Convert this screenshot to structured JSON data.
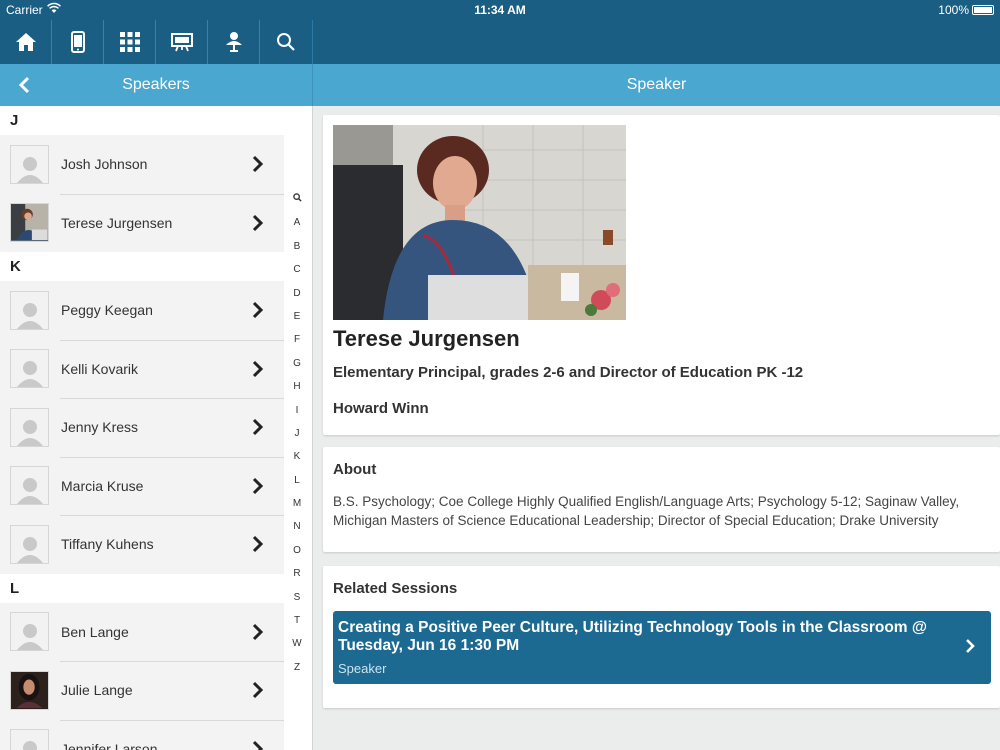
{
  "status_bar": {
    "carrier": "Carrier",
    "time": "11:34 AM",
    "battery": "100%"
  },
  "toolbar": {
    "icons": [
      "home-icon",
      "phone-icon",
      "grid-icon",
      "presentation-icon",
      "speaker-icon",
      "search-icon"
    ]
  },
  "left_header": {
    "title": "Speakers"
  },
  "right_header": {
    "title": "Speaker"
  },
  "speakers": {
    "sections": [
      {
        "letter": "J",
        "items": [
          {
            "name": "Josh Johnson"
          },
          {
            "name": "Terese Jurgensen"
          }
        ]
      },
      {
        "letter": "K",
        "items": [
          {
            "name": "Peggy Keegan"
          },
          {
            "name": "Kelli Kovarik"
          },
          {
            "name": "Jenny Kress"
          },
          {
            "name": "Marcia Kruse"
          },
          {
            "name": "Tiffany Kuhens"
          }
        ]
      },
      {
        "letter": "L",
        "items": [
          {
            "name": "Ben Lange"
          },
          {
            "name": "Julie Lange"
          },
          {
            "name": "Jennifer Larson"
          }
        ]
      }
    ]
  },
  "index_letters": [
    "Q",
    "A",
    "B",
    "C",
    "D",
    "E",
    "F",
    "G",
    "H",
    "I",
    "J",
    "K",
    "L",
    "M",
    "N",
    "O",
    "R",
    "S",
    "T",
    "W",
    "Z"
  ],
  "profile": {
    "name": "Terese Jurgensen",
    "title": "Elementary Principal, grades 2-6 and Director of Education PK -12",
    "organization": "Howard Winn"
  },
  "about": {
    "heading": "About",
    "text": "B.S. Psychology; Coe College Highly Qualified English/Language Arts; Psychology 5-12; Saginaw Valley, Michigan Masters of Science Educational Leadership; Director of Special Education; Drake University"
  },
  "related": {
    "heading": "Related Sessions",
    "sessions": [
      {
        "title": "Creating a Positive Peer Culture, Utilizing Technology Tools in the Classroom @ Tuesday, Jun 16 1:30 PM",
        "role": "Speaker"
      }
    ]
  }
}
